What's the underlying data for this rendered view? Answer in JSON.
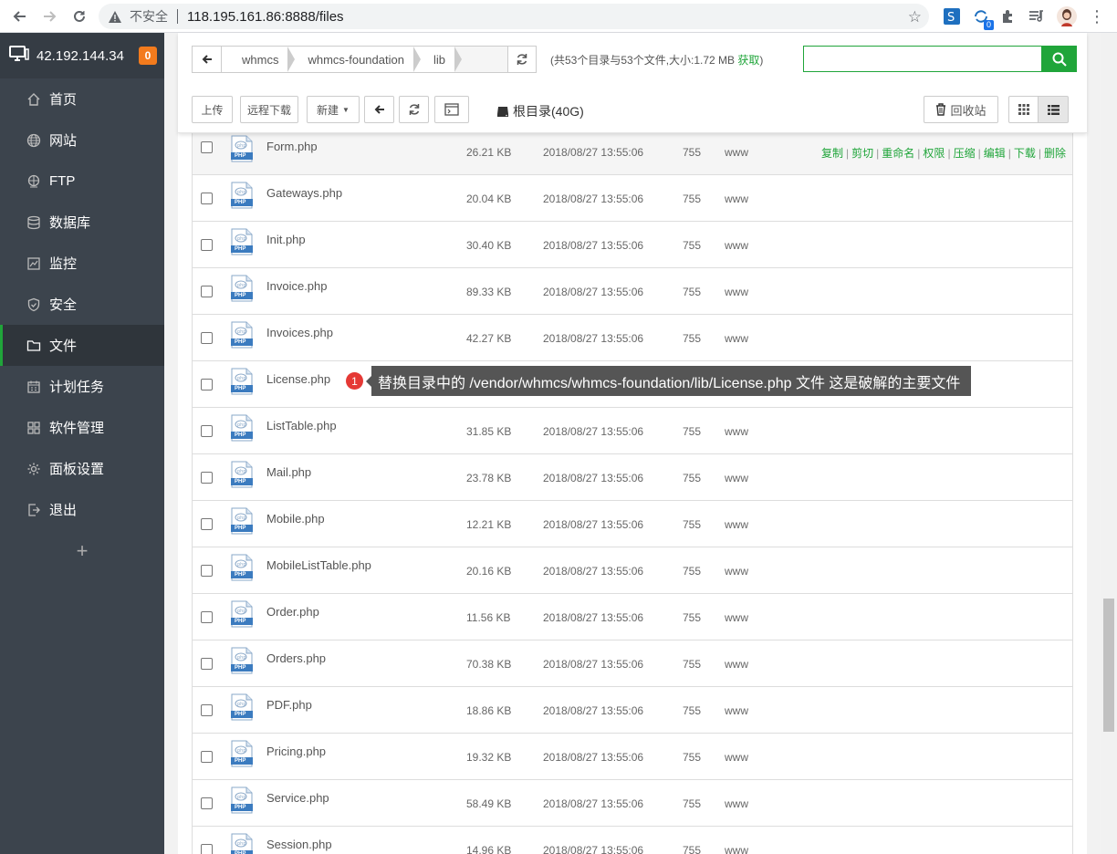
{
  "browser": {
    "insecure_label": "不安全",
    "url": "118.195.161.86:8888/files",
    "ext_badge": "0"
  },
  "sidebar": {
    "host": "42.192.144.34",
    "badge": "0",
    "items": [
      {
        "label": "首页",
        "icon": "home-icon"
      },
      {
        "label": "网站",
        "icon": "globe-icon"
      },
      {
        "label": "FTP",
        "icon": "ftp-icon"
      },
      {
        "label": "数据库",
        "icon": "database-icon"
      },
      {
        "label": "监控",
        "icon": "monitor-icon"
      },
      {
        "label": "安全",
        "icon": "shield-icon"
      },
      {
        "label": "文件",
        "icon": "folder-icon"
      },
      {
        "label": "计划任务",
        "icon": "calendar-icon"
      },
      {
        "label": "软件管理",
        "icon": "grid-icon"
      },
      {
        "label": "面板设置",
        "icon": "gear-icon"
      },
      {
        "label": "退出",
        "icon": "logout-icon"
      }
    ],
    "active_item": "文件",
    "add_label": "+"
  },
  "toolbar": {
    "breadcrumbs": [
      "whmcs",
      "whmcs-foundation",
      "lib"
    ],
    "dir_info": "(共53个目录与53个文件,大小:1.72 MB ",
    "fetch_label": "获取",
    "dir_info_close": ")",
    "search_placeholder": "",
    "upload_label": "上传",
    "remote_download_label": "远程下载",
    "new_label": "新建",
    "root_dir_label": "根目录(40G)",
    "recycle_label": "回收站"
  },
  "files": [
    {
      "name": "Form.php",
      "size": "26.21 KB",
      "date": "2018/08/27 13:55:06",
      "perm": "755",
      "owner": "www"
    },
    {
      "name": "Gateways.php",
      "size": "20.04 KB",
      "date": "2018/08/27 13:55:06",
      "perm": "755",
      "owner": "www"
    },
    {
      "name": "Init.php",
      "size": "30.40 KB",
      "date": "2018/08/27 13:55:06",
      "perm": "755",
      "owner": "www"
    },
    {
      "name": "Invoice.php",
      "size": "89.33 KB",
      "date": "2018/08/27 13:55:06",
      "perm": "755",
      "owner": "www"
    },
    {
      "name": "Invoices.php",
      "size": "42.27 KB",
      "date": "2018/08/27 13:55:06",
      "perm": "755",
      "owner": "www"
    },
    {
      "name": "License.php",
      "size": "",
      "date": "",
      "perm": "",
      "owner": ""
    },
    {
      "name": "ListTable.php",
      "size": "31.85 KB",
      "date": "2018/08/27 13:55:06",
      "perm": "755",
      "owner": "www"
    },
    {
      "name": "Mail.php",
      "size": "23.78 KB",
      "date": "2018/08/27 13:55:06",
      "perm": "755",
      "owner": "www"
    },
    {
      "name": "Mobile.php",
      "size": "12.21 KB",
      "date": "2018/08/27 13:55:06",
      "perm": "755",
      "owner": "www"
    },
    {
      "name": "MobileListTable.php",
      "size": "20.16 KB",
      "date": "2018/08/27 13:55:06",
      "perm": "755",
      "owner": "www"
    },
    {
      "name": "Order.php",
      "size": "11.56 KB",
      "date": "2018/08/27 13:55:06",
      "perm": "755",
      "owner": "www"
    },
    {
      "name": "Orders.php",
      "size": "70.38 KB",
      "date": "2018/08/27 13:55:06",
      "perm": "755",
      "owner": "www"
    },
    {
      "name": "PDF.php",
      "size": "18.86 KB",
      "date": "2018/08/27 13:55:06",
      "perm": "755",
      "owner": "www"
    },
    {
      "name": "Pricing.php",
      "size": "19.32 KB",
      "date": "2018/08/27 13:55:06",
      "perm": "755",
      "owner": "www"
    },
    {
      "name": "Service.php",
      "size": "58.49 KB",
      "date": "2018/08/27 13:55:06",
      "perm": "755",
      "owner": "www"
    },
    {
      "name": "Session.php",
      "size": "14.96 KB",
      "date": "2018/08/27 13:55:06",
      "perm": "755",
      "owner": "www"
    }
  ],
  "file_icon_label": "PHP",
  "row_actions": [
    "复制",
    "剪切",
    "重命名",
    "权限",
    "压缩",
    "编辑",
    "下载",
    "删除"
  ],
  "tooltip": {
    "number": "1",
    "text": "替换目录中的  /vendor/whmcs/whmcs-foundation/lib/License.php 文件 这是破解的主要文件"
  },
  "colors": {
    "accent": "#20a53a",
    "sidebar": "#3c444d",
    "badge": "#f37b1d",
    "tip_dot": "#e53935"
  }
}
